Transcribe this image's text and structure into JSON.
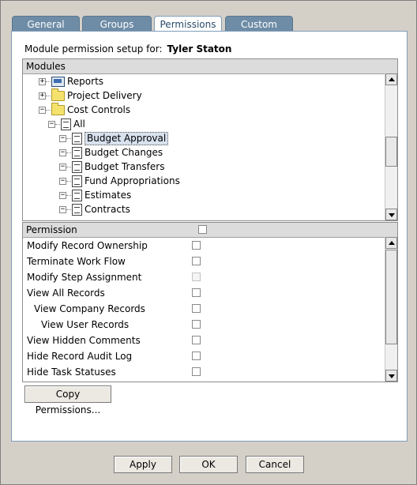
{
  "tabs": [
    {
      "label": "General"
    },
    {
      "label": "Groups"
    },
    {
      "label": "Permissions"
    },
    {
      "label": "Custom"
    }
  ],
  "header": {
    "prefix": "Module permission setup for:",
    "user": "Tyler Staton"
  },
  "modules": {
    "title": "Modules",
    "items": [
      {
        "label": "Reports",
        "icon": "report-icon",
        "expander": "+"
      },
      {
        "label": "Project Delivery",
        "icon": "folder-icon",
        "expander": "+"
      },
      {
        "label": "Cost Controls",
        "icon": "folder-icon",
        "expander": "−"
      },
      {
        "label": "All",
        "icon": "document-icon",
        "expander": "−"
      },
      {
        "label": "Budget Approval",
        "icon": "document-icon",
        "expander": "−",
        "selected": true
      },
      {
        "label": "Budget Changes",
        "icon": "document-icon",
        "expander": "−"
      },
      {
        "label": "Budget Transfers",
        "icon": "document-icon",
        "expander": "−"
      },
      {
        "label": "Fund Appropriations",
        "icon": "document-icon",
        "expander": "−"
      },
      {
        "label": "Estimates",
        "icon": "document-icon",
        "expander": "−"
      },
      {
        "label": "Contracts",
        "icon": "document-icon",
        "expander": "−"
      }
    ]
  },
  "permissions": {
    "title": "Permission",
    "rows": [
      {
        "label": "Modify Record Ownership",
        "checked": false,
        "enabled": true
      },
      {
        "label": "Terminate Work Flow",
        "checked": false,
        "enabled": true
      },
      {
        "label": "Modify Step Assignment",
        "checked": false,
        "enabled": false
      },
      {
        "label": "View All Records",
        "checked": false,
        "enabled": true
      },
      {
        "label": "View Company Records",
        "checked": false,
        "enabled": true
      },
      {
        "label": "View User Records",
        "checked": false,
        "enabled": true
      },
      {
        "label": "View Hidden Comments",
        "checked": false,
        "enabled": true
      },
      {
        "label": "Hide Record Audit Log",
        "checked": false,
        "enabled": true
      },
      {
        "label": "Hide Task Statuses",
        "checked": false,
        "enabled": true
      }
    ]
  },
  "copy_button": "Copy Permissions...",
  "footer": {
    "apply": "Apply",
    "ok": "OK",
    "cancel": "Cancel"
  }
}
